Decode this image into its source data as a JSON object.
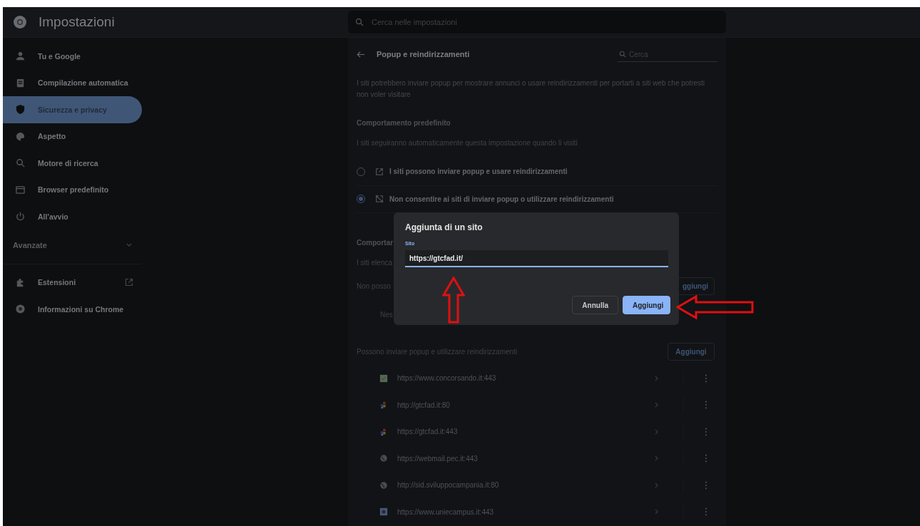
{
  "header": {
    "title": "Impostazioni",
    "search": {
      "placeholder": "Cerca nelle impostazioni"
    }
  },
  "sidebar": {
    "items": [
      {
        "label": "Tu e Google",
        "selected": false
      },
      {
        "label": "Compilazione automatica",
        "selected": false
      },
      {
        "label": "Sicurezza e privacy",
        "selected": true
      },
      {
        "label": "Aspetto",
        "selected": false
      },
      {
        "label": "Motore di ricerca",
        "selected": false
      },
      {
        "label": "Browser predefinito",
        "selected": false
      },
      {
        "label": "All'avvio",
        "selected": false
      }
    ],
    "advanced": {
      "label": "Avanzate",
      "expanded": false
    },
    "links": [
      {
        "label": "Estensioni"
      },
      {
        "label": "Informazioni su Chrome"
      }
    ]
  },
  "page": {
    "title": "Popup e reindirizzamenti",
    "search": {
      "placeholder": "Cerca"
    },
    "description": "I siti potrebbero inviare popup per mostrare annunci o usare reindirizzamenti per portarti a siti web che potresti non voler visitare",
    "default_behavior": {
      "heading": "Comportamento predefinito",
      "subtext": "I siti seguiranno automaticamente questa impostazione quando li visiti",
      "options": [
        {
          "label": "I siti possono inviare popup e usare reindirizzamenti",
          "selected": false
        },
        {
          "label": "Non consentire ai siti di inviare popup o utilizzare reindirizzamenti",
          "selected": true
        }
      ]
    },
    "custom": {
      "heading": "Comportar",
      "subtext": "I siti elenca",
      "blocked_label": "Non posso",
      "blocked_add": "ggiungi",
      "blocked_empty": "Nes"
    },
    "allowed": {
      "label": "Possono inviare popup e utilizzare reindirizzamenti",
      "add": "Aggiungi",
      "sites": [
        {
          "url": "https://www.concorsando.it:443"
        },
        {
          "url": "http://gtcfad.it:80"
        },
        {
          "url": "https://gtcfad.it:443"
        },
        {
          "url": "https://webmail.pec.it:443"
        },
        {
          "url": "http://sid.sviluppocampania.it:80"
        },
        {
          "url": "https://www.uniecampus.it:443"
        }
      ]
    }
  },
  "dialog": {
    "title": "Aggiunta di un sito",
    "field": {
      "label": "Sito",
      "value": "https://gtcfad.it/"
    },
    "buttons": [
      {
        "label": "Annulla",
        "kind": "secondary"
      },
      {
        "label": "Aggiungi",
        "kind": "primary"
      }
    ]
  }
}
